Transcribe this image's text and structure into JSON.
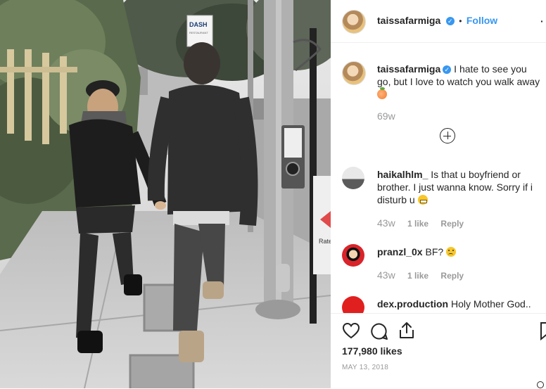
{
  "post": {
    "username": "taissafarmiga",
    "follow_label": "Follow",
    "caption_text": "I hate to see you go, but I love to watch you walk away",
    "caption_emoji": "peach",
    "caption_age": "69w",
    "likes": "177,980 likes",
    "date": "MAY 13, 2018"
  },
  "photo": {
    "sign_text": "DASH",
    "sign_text2": "RESTAURANT",
    "sign_side": "Rate"
  },
  "comments": [
    {
      "username": "haikalhlm_",
      "text": "Is that u boyfriend or brother. I just wanna know. Sorry if i disturb u",
      "emoji": "grin",
      "age": "43w",
      "likes": "1 like",
      "reply": "Reply"
    },
    {
      "username": "pranzl_0x",
      "text": "BF?",
      "emoji": "frown",
      "age": "43w",
      "likes": "1 like",
      "reply": "Reply"
    },
    {
      "username": "dex.production",
      "text": "Holy Mother God..",
      "emoji": "",
      "age": "",
      "likes": "",
      "reply": ""
    }
  ],
  "colors": {
    "accent": "#3897f0",
    "text": "#262626",
    "muted": "#999999"
  }
}
